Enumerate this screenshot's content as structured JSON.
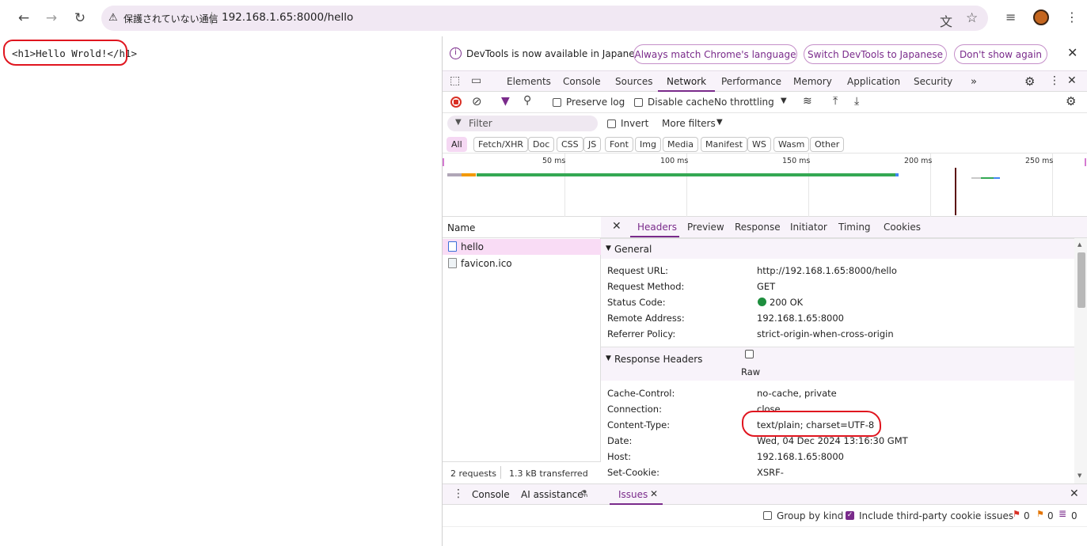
{
  "browser": {
    "security_label": "保護されていない通信",
    "url": "192.168.1.65:8000/hello"
  },
  "page": {
    "content": "<h1>Hello Wrold!</h1>"
  },
  "devtools": {
    "notice": {
      "text": "DevTools is now available in Japanese!",
      "btn_match": "Always match Chrome's language",
      "btn_switch": "Switch DevTools to Japanese",
      "btn_dont": "Don't show again"
    },
    "tabs": [
      "Elements",
      "Console",
      "Sources",
      "Network",
      "Performance",
      "Memory",
      "Application",
      "Security"
    ],
    "toolbar": {
      "preserve_log": "Preserve log",
      "disable_cache": "Disable cache",
      "throttling": "No throttling"
    },
    "filter": {
      "placeholder": "Filter",
      "invert": "Invert",
      "more_filters": "More filters"
    },
    "type_filters": [
      "All",
      "Fetch/XHR",
      "Doc",
      "CSS",
      "JS",
      "Font",
      "Img",
      "Media",
      "Manifest",
      "WS",
      "Wasm",
      "Other"
    ],
    "timeline": {
      "ticks": [
        "50 ms",
        "100 ms",
        "150 ms",
        "200 ms",
        "250 ms"
      ]
    },
    "requests": {
      "column_name": "Name",
      "items": [
        "hello",
        "favicon.ico"
      ],
      "summary_requests": "2 requests",
      "summary_transferred": "1.3 kB transferred"
    },
    "detail_tabs": [
      "Headers",
      "Preview",
      "Response",
      "Initiator",
      "Timing",
      "Cookies"
    ],
    "general": {
      "title": "General",
      "rows": [
        {
          "key": "Request URL:",
          "value": "http://192.168.1.65:8000/hello"
        },
        {
          "key": "Request Method:",
          "value": "GET"
        },
        {
          "key": "Status Code:",
          "value": "200 OK"
        },
        {
          "key": "Remote Address:",
          "value": "192.168.1.65:8000"
        },
        {
          "key": "Referrer Policy:",
          "value": "strict-origin-when-cross-origin"
        }
      ]
    },
    "response_headers": {
      "title": "Response Headers",
      "raw_label": "Raw",
      "rows": [
        {
          "key": "Cache-Control:",
          "value": "no-cache, private"
        },
        {
          "key": "Connection:",
          "value": "close"
        },
        {
          "key": "Content-Type:",
          "value": "text/plain; charset=UTF-8"
        },
        {
          "key": "Date:",
          "value": "Wed, 04 Dec 2024 13:16:30 GMT"
        },
        {
          "key": "Host:",
          "value": "192.168.1.65:8000"
        },
        {
          "key": "Set-Cookie:",
          "value": "XSRF-"
        }
      ]
    },
    "drawer": {
      "tabs": [
        "Console",
        "AI assistance",
        "Issues"
      ],
      "group_by_kind": "Group by kind",
      "third_party": "Include third-party cookie issues",
      "count_errors": "0",
      "count_warnings": "0",
      "count_info": "0"
    },
    "colors": {
      "accent": "#7a2b8b",
      "status_ok": "#1e8e3e",
      "annotation": "#e0151f"
    }
  }
}
